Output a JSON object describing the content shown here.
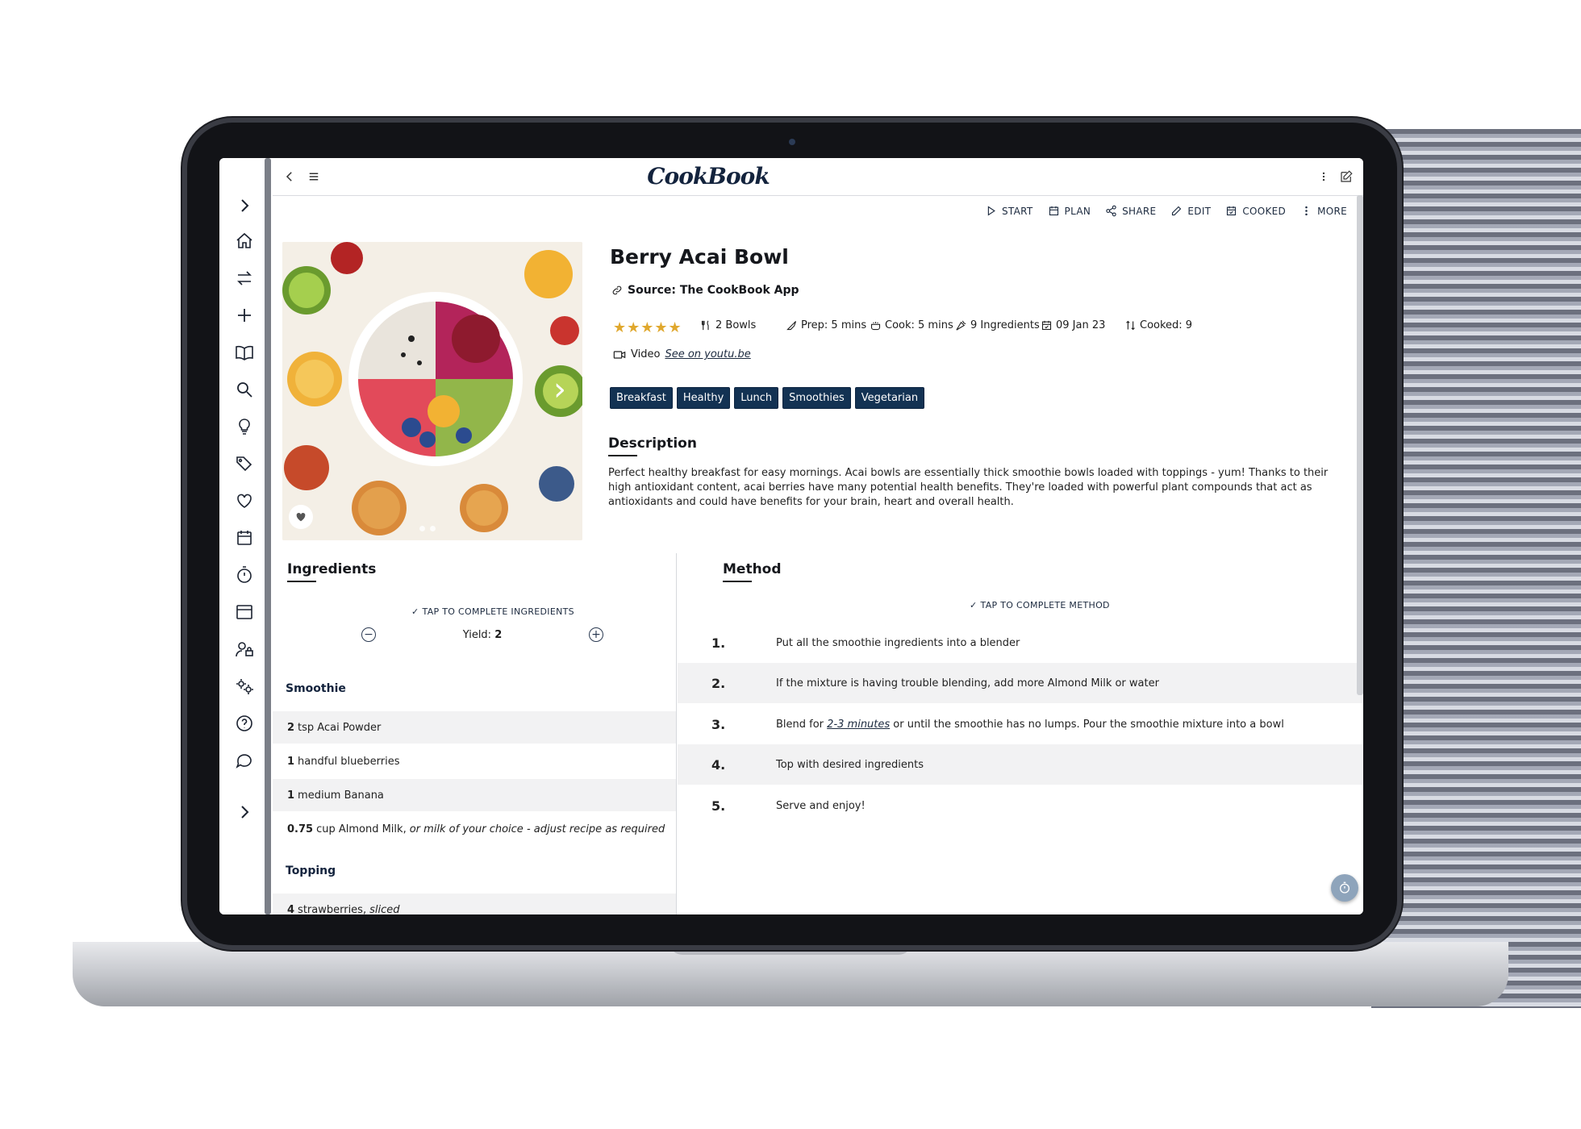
{
  "app": {
    "logo": "CookBook"
  },
  "toolbar": {
    "actions": [
      {
        "label": "START",
        "icon": "play-icon"
      },
      {
        "label": "PLAN",
        "icon": "calendar-icon"
      },
      {
        "label": "SHARE",
        "icon": "share-icon"
      },
      {
        "label": "EDIT",
        "icon": "edit-icon"
      },
      {
        "label": "COOKED",
        "icon": "calendar-check-icon"
      },
      {
        "label": "MORE",
        "icon": "more-vertical-icon"
      }
    ]
  },
  "recipe": {
    "title": "Berry Acai Bowl",
    "source_label": "Source",
    "source_value": ": The CookBook App",
    "rating": 5,
    "stars": "★★★★★",
    "servings": "2 Bowls",
    "prep": "Prep: 5 mins",
    "cook": "Cook: 5 mins",
    "ingredients_count": "9 Ingredients",
    "date": "09 Jan 23",
    "cooked": "Cooked: 9",
    "video_label": "Video",
    "video_link": "See on youtu.be",
    "tags": [
      "Breakfast",
      "Healthy",
      "Lunch",
      "Smoothies",
      "Vegetarian"
    ],
    "description_heading": "Description",
    "description": "Perfect healthy breakfast for easy mornings. Acai bowls are essentially thick smoothie bowls loaded with toppings - yum! Thanks to their high antioxidant content, acai berries have many potential health benefits. They're loaded with powerful plant compounds that act as antioxidants and could have benefits for your brain, heart and overall health."
  },
  "ingredients": {
    "heading": "Ingredients",
    "tap_text": "TAP TO COMPLETE INGREDIENTS",
    "yield_label": "Yield:",
    "yield_value": "2",
    "sections": [
      {
        "name": "Smoothie",
        "items": [
          {
            "qty": "2",
            "text": "tsp Acai Powder",
            "note": ""
          },
          {
            "qty": "1",
            "text": "handful blueberries",
            "note": ""
          },
          {
            "qty": "1",
            "text": "medium Banana",
            "note": ""
          },
          {
            "qty": "0.75",
            "text": "cup Almond Milk,",
            "note": "or milk of your choice - adjust recipe as required"
          }
        ]
      },
      {
        "name": "Topping",
        "items": [
          {
            "qty": "4",
            "text": "strawberries,",
            "note": "sliced"
          }
        ]
      }
    ]
  },
  "method": {
    "heading": "Method",
    "tap_text": "TAP TO COMPLETE METHOD",
    "steps": [
      {
        "n": "1.",
        "pre": "Put all the smoothie ingredients into a blender",
        "link": "",
        "post": ""
      },
      {
        "n": "2.",
        "pre": "If the mixture is having trouble blending, add more Almond Milk or water",
        "link": "",
        "post": ""
      },
      {
        "n": "3.",
        "pre": "Blend for ",
        "link": "2-3 minutes",
        "post": " or until the smoothie has no lumps. Pour the smoothie mixture into a bowl"
      },
      {
        "n": "4.",
        "pre": "Top with desired ingredients",
        "link": "",
        "post": ""
      },
      {
        "n": "5.",
        "pre": "Serve and enjoy!",
        "link": "",
        "post": ""
      }
    ]
  },
  "colors": {
    "accent": "#133253",
    "star": "#e0a82e",
    "rowAlt": "#f2f2f3"
  }
}
